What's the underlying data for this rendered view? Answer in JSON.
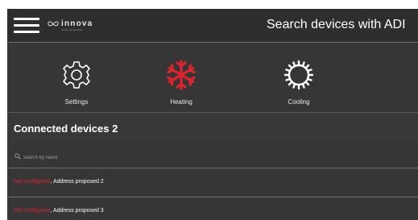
{
  "header": {
    "logo_text": "innova",
    "logo_sub": "clima di qualità",
    "title": "Search devices with ADI"
  },
  "modes": [
    {
      "label": "Settings",
      "icon": "gear-icon"
    },
    {
      "label": "Heating",
      "icon": "snowflake-icon"
    },
    {
      "label": "Cooling",
      "icon": "sun-icon"
    }
  ],
  "colors": {
    "accent": "#e0232b",
    "background": "#363636",
    "header": "#2e2e2e"
  },
  "connected": {
    "title": "Connected devices 2"
  },
  "search": {
    "placeholder": "search by name"
  },
  "devices": [
    {
      "status": "Not configured",
      "separator": ", ",
      "address": "Address proposed 2"
    },
    {
      "status": "Not configured",
      "separator": ", ",
      "address": "Address proposed 3"
    }
  ]
}
